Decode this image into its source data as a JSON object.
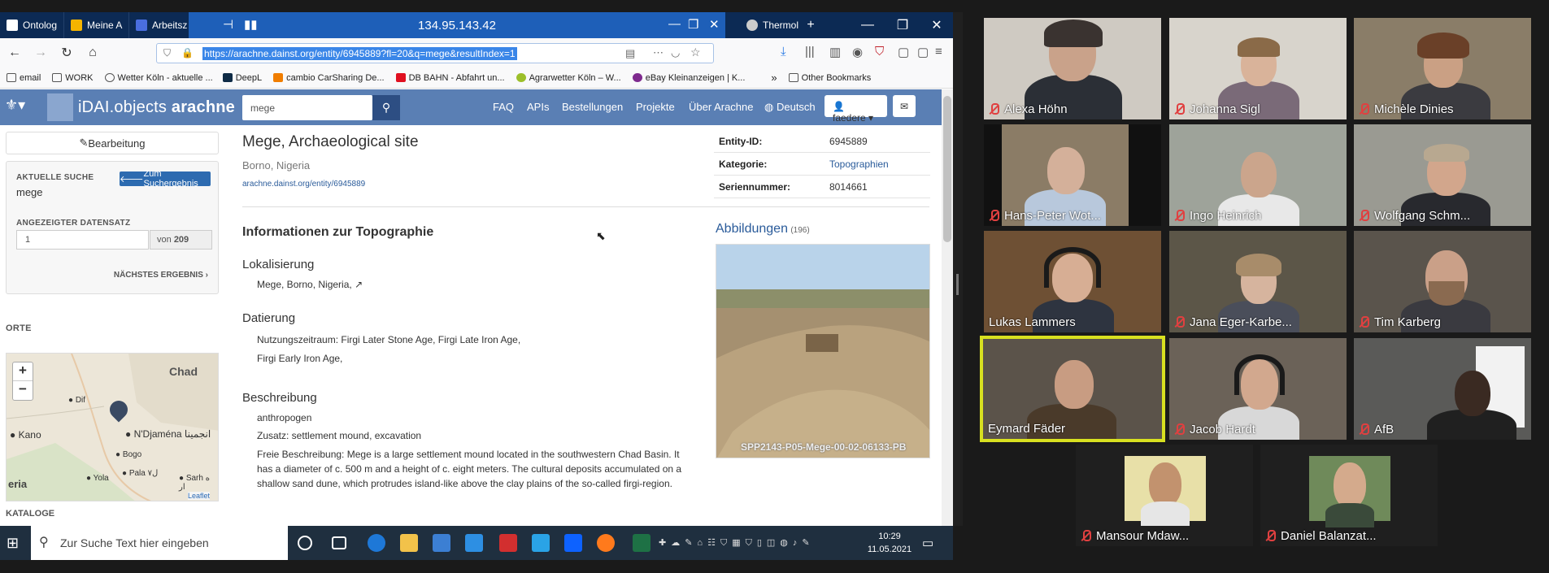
{
  "browser": {
    "tabs": [
      "Ontolog",
      "Meine A",
      "Arbeitsz",
      "Thermol"
    ],
    "remote_title": "134.95.143.42",
    "url": "https://arachne.dainst.org/entity/6945889?fl=20&q=mege&resultIndex=1",
    "bookmarks": [
      "email",
      "WORK",
      "Wetter Köln - aktuelle ...",
      "DeepL",
      "cambio CarSharing De...",
      "DB BAHN - Abfahrt un...",
      "Agrarwetter Köln – W...",
      "eBay Kleinanzeigen | K...",
      "Other Bookmarks"
    ]
  },
  "site": {
    "logo_light": "iDAI.objects",
    "logo_bold": "arachne",
    "search_value": "mege",
    "nav": [
      "FAQ",
      "APIs",
      "Bestellungen",
      "Projekte",
      "Über Arachne",
      "Deutsch"
    ],
    "user": "faedere",
    "sidebar": {
      "edit_button": "Bearbeitung",
      "current_search_label": "AKTUELLE SUCHE",
      "current_search_value": "mege",
      "back_button": "Zum Suchergebnis",
      "record_label": "ANGEZEIGTER DATENSATZ",
      "record_value": "1",
      "record_of": "von",
      "record_total": "209",
      "next_result": "NÄCHSTES ERGEBNIS",
      "places_label": "ORTE",
      "catalog_label": "KATALOGE",
      "map": {
        "zoom_in": "+",
        "zoom_out": "−",
        "labels": [
          "Chad",
          "Dif",
          "Kano",
          "N'Djaména انجمينا",
          "Bogo",
          "Pala ۷ل",
          "Yola",
          "Sarh ە ار",
          "eria"
        ],
        "attribution": "Leaflet"
      }
    },
    "entity": {
      "title": "Mege, Archaeological site",
      "subtitle": "Borno, Nigeria",
      "link": "arachne.dainst.org/entity/6945889",
      "section_title": "Informationen zur Topographie",
      "loc_heading": "Lokalisierung",
      "loc_value": "Mege, Borno, Nigeria,",
      "date_heading": "Datierung",
      "date_line1": "Nutzungszeitraum: Firgi Later Stone Age, Firgi Late Iron Age,",
      "date_line2": "Firgi Early Iron Age,",
      "desc_heading": "Beschreibung",
      "desc_line1": "anthropogen",
      "desc_line2": "Zusatz: settlement mound, excavation",
      "desc_text": "Freie Beschreibung: Mege is a large settlement mound located in the southwestern Chad Basin. It has a diameter of c. 500 m and a height of c. eight meters. The cultural deposits accumulated on a shallow sand dune, which protrudes island-like above the clay plains of the so-called firgi-region."
    },
    "info": {
      "rows": [
        {
          "k": "Entity-ID:",
          "v": "6945889"
        },
        {
          "k": "Kategorie:",
          "v": "Topographien"
        },
        {
          "k": "Seriennummer:",
          "v": "8014661"
        }
      ],
      "images_label": "Abbildungen",
      "images_count": "(196)",
      "image_caption": "SPP2143-P05-Mege-00-02-06133-PB"
    }
  },
  "taskbar": {
    "search_placeholder": "Zur Suche Text hier eingeben",
    "time": "10:29",
    "date": "11.05.2021"
  },
  "participants": [
    "Alexa Höhn",
    "Johanna Sigl",
    "Michèle Dinies",
    "Hans-Peter Wot...",
    "Ingo Heinrich",
    "Wolfgang Schm...",
    "Lukas Lammers",
    "Jana Eger-Karbe...",
    "Tim Karberg",
    "Eymard Fäder",
    "Jacob Hardt",
    "AfB",
    "Mansour Mdaw...",
    "Daniel Balanzat..."
  ]
}
